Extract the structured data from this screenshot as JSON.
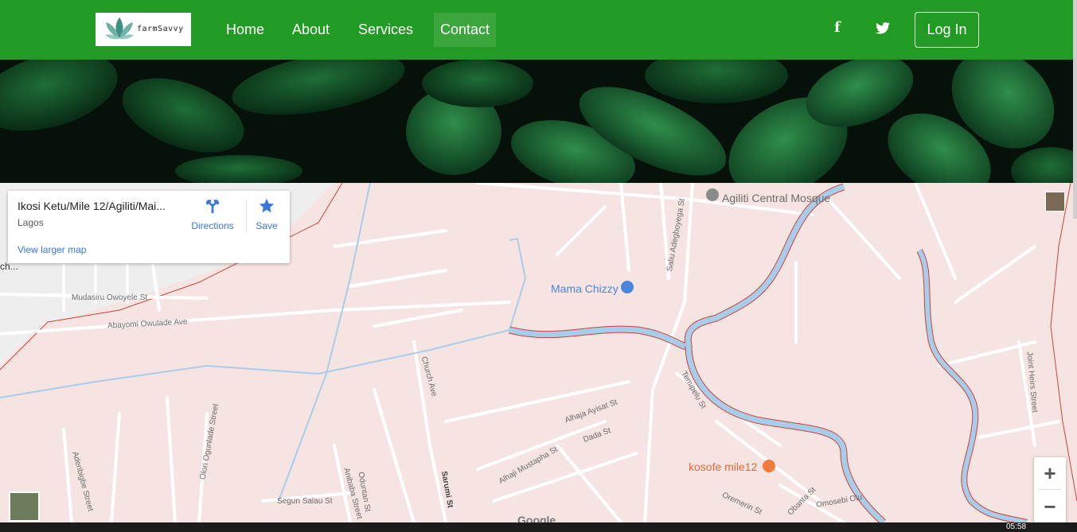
{
  "navbar": {
    "logo_text": "farmSavvy",
    "items": [
      {
        "label": "Home"
      },
      {
        "label": "About"
      },
      {
        "label": "Services"
      },
      {
        "label": "Contact"
      }
    ],
    "social": {
      "facebook": "f",
      "twitter": "twitter"
    },
    "login_label": "Log In",
    "bg_color": "#229b25"
  },
  "map": {
    "place_title": "Ikosi Ketu/Mile 12/Agiliti/Mai...",
    "place_sub": "Lagos",
    "directions_label": "Directions",
    "save_label": "Save",
    "larger_map_label": "View larger map",
    "edge_label": "ch...",
    "pois": {
      "mosque": "Agiliti Central Mosque",
      "store": "Mama Chizzy",
      "restaurant": "kosofe mile12"
    },
    "streets": [
      "Mudasiru Owoyele St",
      "Abayomi Owulade Ave",
      "Church Ave",
      "Alhaja Ayisat St",
      "Dada St",
      "Alhaji Mustapha St",
      "Temipelu St",
      "Saliu Adegboyega St",
      "Olori Ogunlade Street",
      "Aderibigbe Street",
      "Segun Salau St",
      "Anibaba Street",
      "Oduntan St",
      "Sarumi St",
      "Joint Heirs Street",
      "Oremerin St",
      "Obanta St",
      "Omosebi Olu"
    ],
    "google_label": "Google",
    "zoom_in": "+",
    "zoom_out": "−"
  },
  "taskbar": {
    "clock": "05:58"
  }
}
